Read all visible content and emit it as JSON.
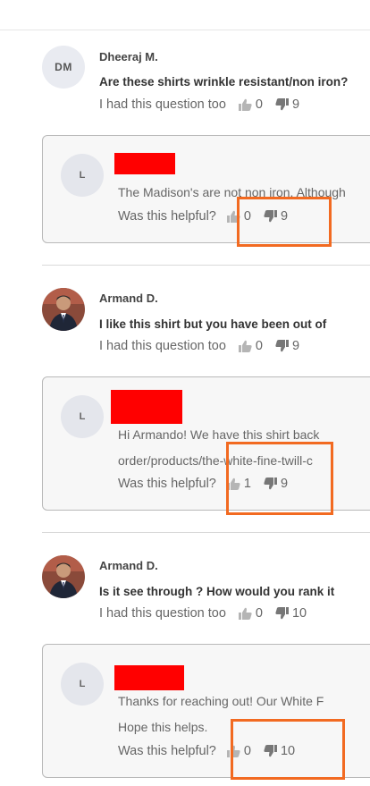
{
  "questions": [
    {
      "avatar_initials": "DM",
      "author": "Dheeraj M.",
      "question": "Are these shirts wrinkle resistant/non iron?",
      "had_question_label": "I had this question too",
      "up": "0",
      "down": "9",
      "answer": {
        "avatar_initial": "L",
        "lines": [
          "The Madison's are not non iron. Although"
        ],
        "helpful_label": "Was this helpful?",
        "up": "0",
        "down": "9"
      }
    },
    {
      "avatar_initials": "",
      "author": "Armand D.",
      "question": "I like this shirt but you have been out of",
      "had_question_label": "I had this question too",
      "up": "0",
      "down": "9",
      "answer": {
        "avatar_initial": "L",
        "lines": [
          "Hi Armando! We have this shirt back",
          "order/products/the-white-fine-twill-c"
        ],
        "helpful_label": "Was this helpful?",
        "up": "1",
        "down": "9"
      }
    },
    {
      "avatar_initials": "",
      "author": "Armand D.",
      "question": "Is it see through ? How would you rank it",
      "had_question_label": "I had this question too",
      "up": "0",
      "down": "10",
      "answer": {
        "avatar_initial": "L",
        "lines": [
          "Thanks for reaching out! Our White F",
          "Hope this helps."
        ],
        "helpful_label": "Was this helpful?",
        "up": "0",
        "down": "10"
      }
    }
  ],
  "colors": {
    "highlight": "#f26a21",
    "redaction": "#ff0000"
  },
  "icons": {
    "up": "thumbs-up-icon",
    "down": "thumbs-down-icon"
  }
}
